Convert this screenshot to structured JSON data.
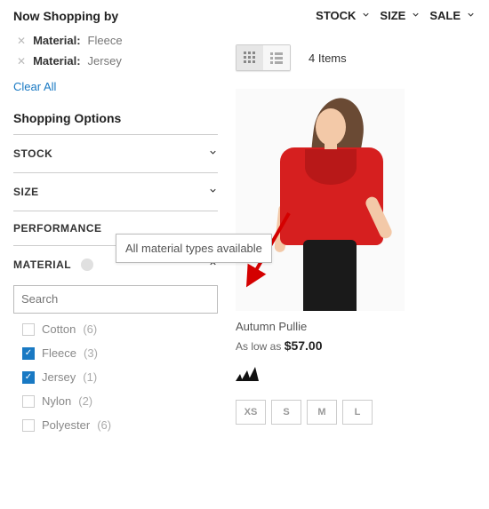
{
  "top_dropdowns": [
    {
      "label": "STOCK"
    },
    {
      "label": "SIZE"
    },
    {
      "label": "SALE"
    }
  ],
  "now_shopping": {
    "title": "Now Shopping by",
    "applied": [
      {
        "label": "Material:",
        "value": "Fleece"
      },
      {
        "label": "Material:",
        "value": "Jersey"
      }
    ],
    "clear_all": "Clear All"
  },
  "shopping_options_title": "Shopping Options",
  "facets": [
    {
      "label": "STOCK"
    },
    {
      "label": "SIZE"
    },
    {
      "label": "PERFORMANCE"
    }
  ],
  "material": {
    "label": "MATERIAL",
    "tooltip": "All material types available",
    "search_placeholder": "Search",
    "options": [
      {
        "label": "Cotton",
        "count": "(6)",
        "checked": false
      },
      {
        "label": "Fleece",
        "count": "(3)",
        "checked": true
      },
      {
        "label": "Jersey",
        "count": "(1)",
        "checked": true
      },
      {
        "label": "Nylon",
        "count": "(2)",
        "checked": false
      },
      {
        "label": "Polyester",
        "count": "(6)",
        "checked": false
      }
    ]
  },
  "toolbar": {
    "item_count": "4 Items"
  },
  "product": {
    "name": "Autumn Pullie",
    "price_prefix": "As low as ",
    "price": "$57.00",
    "sizes": [
      "XS",
      "S",
      "M",
      "L"
    ]
  },
  "colors": {
    "link": "#1979c3",
    "accent_red": "#d61f1f",
    "arrow": "#d40000"
  }
}
